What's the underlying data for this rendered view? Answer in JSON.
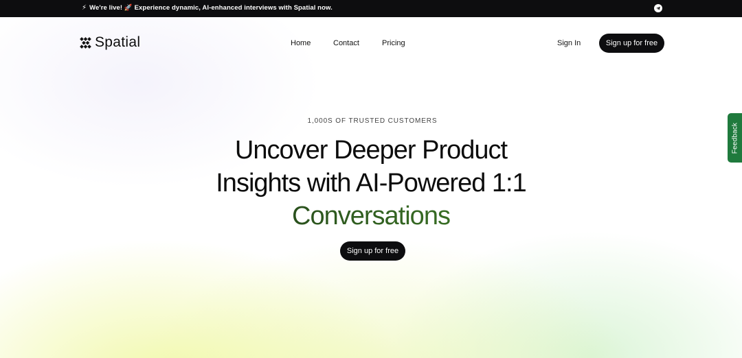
{
  "announcement": {
    "text": "We're live! 🚀 Experience dynamic, AI-enhanced interviews with Spatial now.",
    "leading_icon": "sparkle-icon",
    "social_icon": "telegram-icon"
  },
  "nav": {
    "logo_text": "Spatial",
    "links": [
      "Home",
      "Contact",
      "Pricing"
    ],
    "signin_label": "Sign In",
    "cta_label": "Sign up for free"
  },
  "hero": {
    "eyebrow": "1,000S OF TRUSTED CUSTOMERS",
    "headline_line1": "Uncover Deeper Product",
    "headline_line2": "Insights with AI-Powered 1:1",
    "headline_line3": "Conversations",
    "cta_label": "Sign up for free"
  },
  "feedback_tab": {
    "label": "Feedback"
  },
  "colors": {
    "dark": "#0d0d0f",
    "accent_green": "#4f9a2f",
    "feedback_green": "#1f7a3d"
  }
}
